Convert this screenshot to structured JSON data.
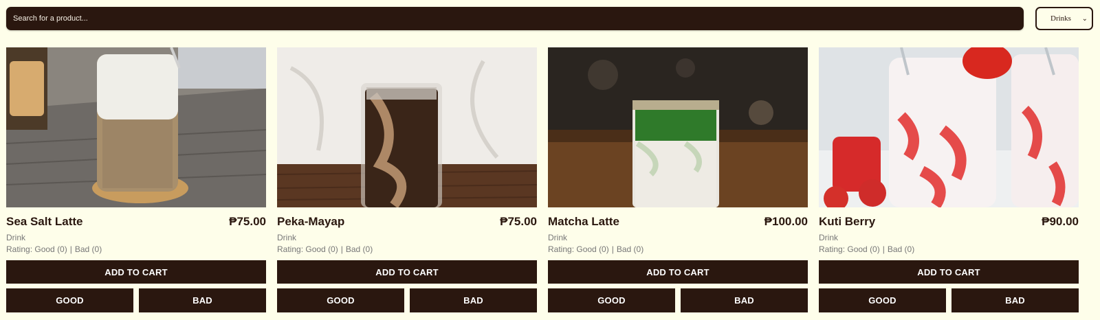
{
  "search": {
    "placeholder": "Search for a product..."
  },
  "filter": {
    "selected": "Drinks"
  },
  "products": [
    {
      "name": "Sea Salt Latte",
      "price": "₱75.00",
      "category": "Drink",
      "rating_prefix": "Rating:",
      "good_text": "Good (0)",
      "bad_text": "Bad (0)",
      "add_to_cart": "ADD TO CART",
      "good_button": "GOOD",
      "bad_button": "BAD"
    },
    {
      "name": "Peka-Mayap",
      "price": "₱75.00",
      "category": "Drink",
      "rating_prefix": "Rating:",
      "good_text": "Good (0)",
      "bad_text": "Bad (0)",
      "add_to_cart": "ADD TO CART",
      "good_button": "GOOD",
      "bad_button": "BAD"
    },
    {
      "name": "Matcha Latte",
      "price": "₱100.00",
      "category": "Drink",
      "rating_prefix": "Rating:",
      "good_text": "Good (0)",
      "bad_text": "Bad (0)",
      "add_to_cart": "ADD TO CART",
      "good_button": "GOOD",
      "bad_button": "BAD"
    },
    {
      "name": "Kuti Berry",
      "price": "₱90.00",
      "category": "Drink",
      "rating_prefix": "Rating:",
      "good_text": "Good (0)",
      "bad_text": "Bad (0)",
      "add_to_cart": "ADD TO CART",
      "good_button": "GOOD",
      "bad_button": "BAD"
    }
  ],
  "colors": {
    "page_bg": "#fefeea",
    "primary": "#2a170f",
    "muted_text": "#777777"
  }
}
